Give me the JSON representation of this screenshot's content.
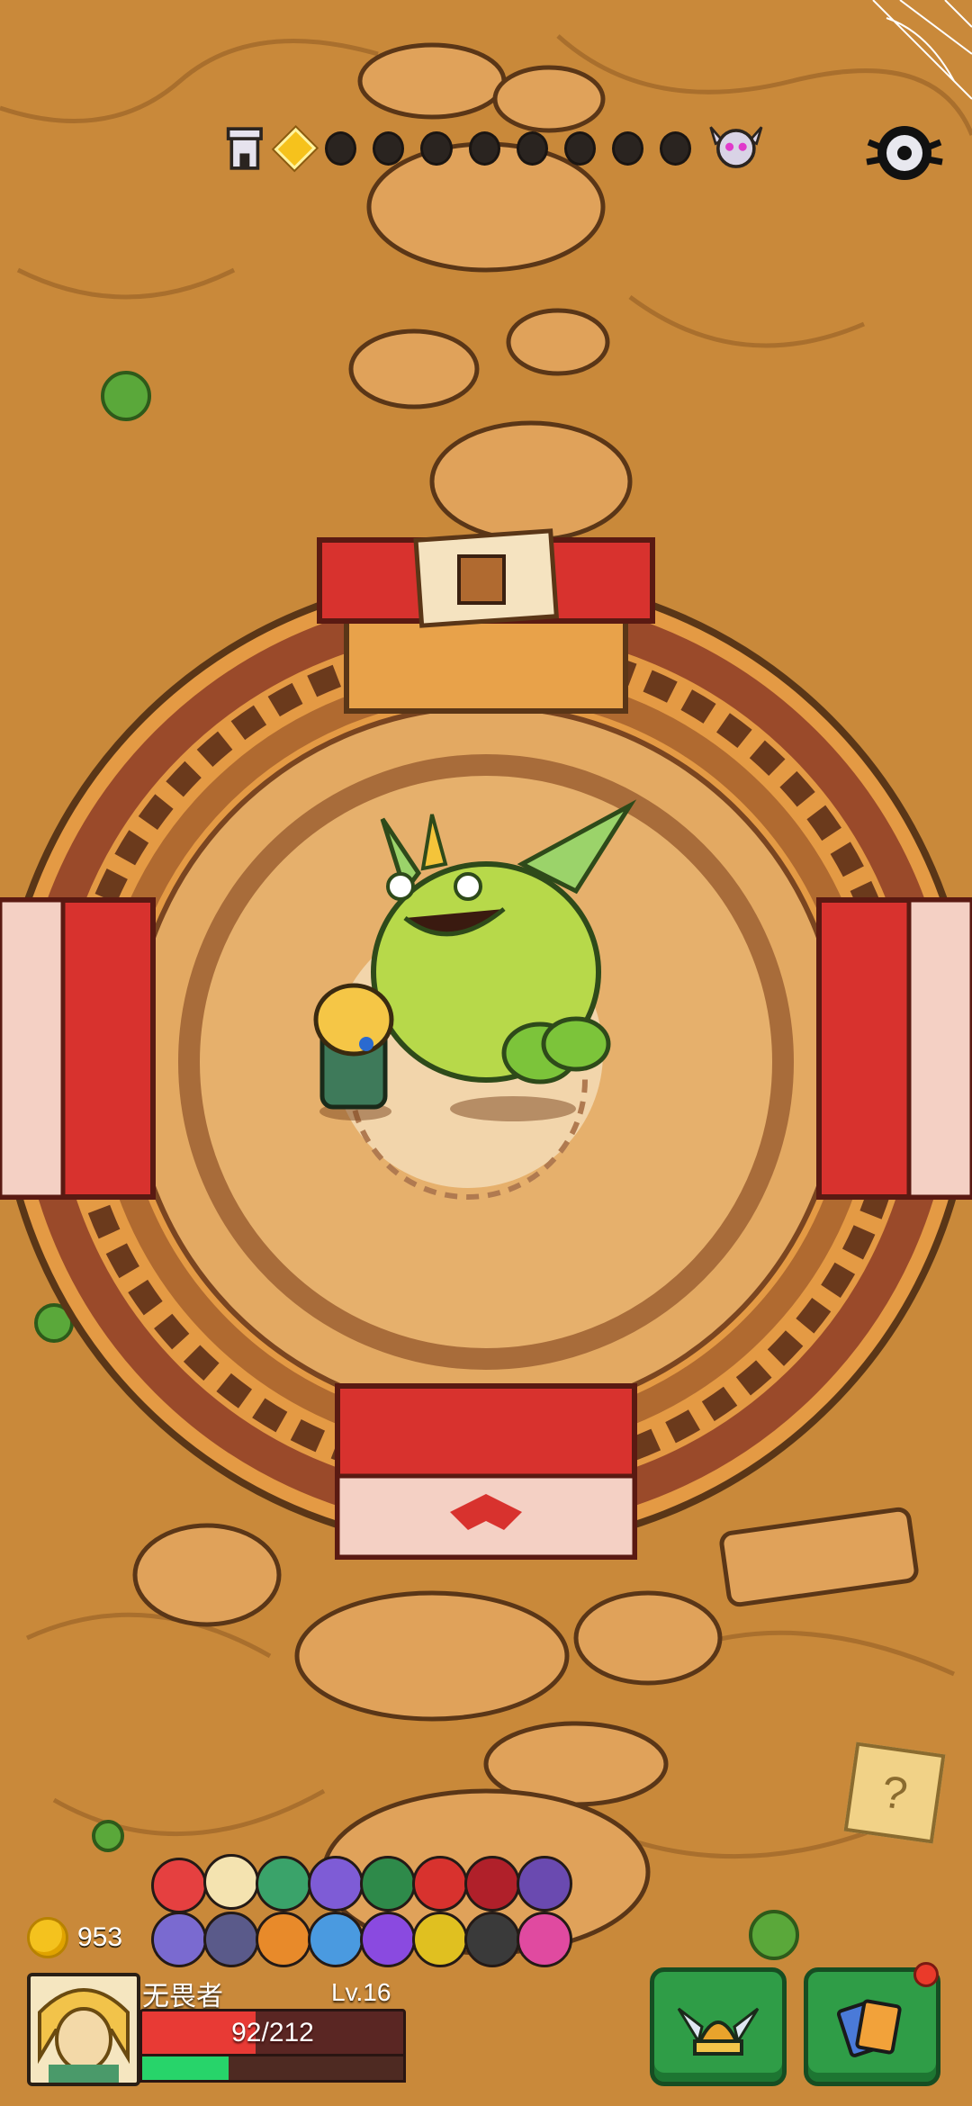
{
  "hud": {
    "progress": {
      "current_index": 0,
      "total_nodes": 9,
      "start_icon": "tower-icon",
      "boss_icon": "demon-skull-icon"
    },
    "settings_icon": "gear-icon",
    "coins": "953",
    "player": {
      "name": "无畏者",
      "level": "Lv.16",
      "hp_text": "92/212",
      "hp_current": 92,
      "hp_max": 212,
      "xp_fraction": 0.33
    },
    "buttons": {
      "equipment_icon": "winged-helmet-icon",
      "cards_icon": "cards-icon",
      "cards_has_notification": true
    },
    "mystery_icon": "question-mark-icon",
    "relic_count": 16
  },
  "colors": {
    "sand": "#c9893a",
    "arena_wall": "#e26a3a",
    "gate_red": "#d8322e",
    "hp": "#e83a35",
    "xp": "#27d46a",
    "button_green": "#2f9d47"
  }
}
